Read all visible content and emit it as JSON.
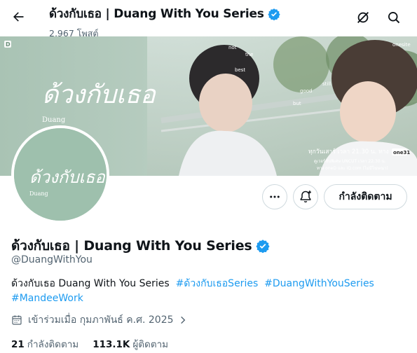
{
  "header": {
    "title": "ด้วงกับเธอ | Duang With You Series",
    "posts_count": "2,967 โพสต์",
    "icons": [
      "back-arrow-icon",
      "verified-badge-icon",
      "grok-icon",
      "search-icon"
    ]
  },
  "banner": {
    "logo_text": "D",
    "corner_logo": "onesite",
    "lyric_words": [
      "not",
      "the",
      "best",
      "good",
      "but",
      "still"
    ],
    "title_art": "ด้วงกับเธอ",
    "title_art_sub": "Duang",
    "airtime": "ทุกวันเสาร์ เวลา 21.30 น. ทาง",
    "channel": "one31",
    "line2": "ดูเวอร์ชันพิเศษ UNCUT เวลา 22.30 น.",
    "line3": "ทาง oneD และ iQ.com (ไม่มีโฆษณา)"
  },
  "avatar": {
    "title_art": "ด้วงกับเธอ",
    "title_art_sub": "Duang"
  },
  "actions": {
    "more_icon": "more-icon",
    "notify_icon": "notification-plus-icon",
    "follow_label": "กำลังติดตาม"
  },
  "profile": {
    "name": "ด้วงกับเธอ | Duang With You Series",
    "handle": "@DuangWithYou",
    "bio_text": "ด้วงกับเธอ Duang With You Series",
    "hashtags": [
      "#ด้วงกับเธอSeries",
      "#DuangWithYouSeries",
      "#MandeeWork"
    ],
    "joined": "เข้าร่วมเมื่อ กุมภาพันธ์ ค.ศ. 2025"
  },
  "stats": {
    "following_count": "21",
    "following_label": "กำลังติดตาม",
    "followers_count": "113.1K",
    "followers_label": "ผู้ติดตาม"
  },
  "colors": {
    "accent": "#1d9bf0",
    "text": "#0f1419",
    "muted": "#536471",
    "border": "#cfd9de",
    "banner_green": "#9fb8a9"
  }
}
